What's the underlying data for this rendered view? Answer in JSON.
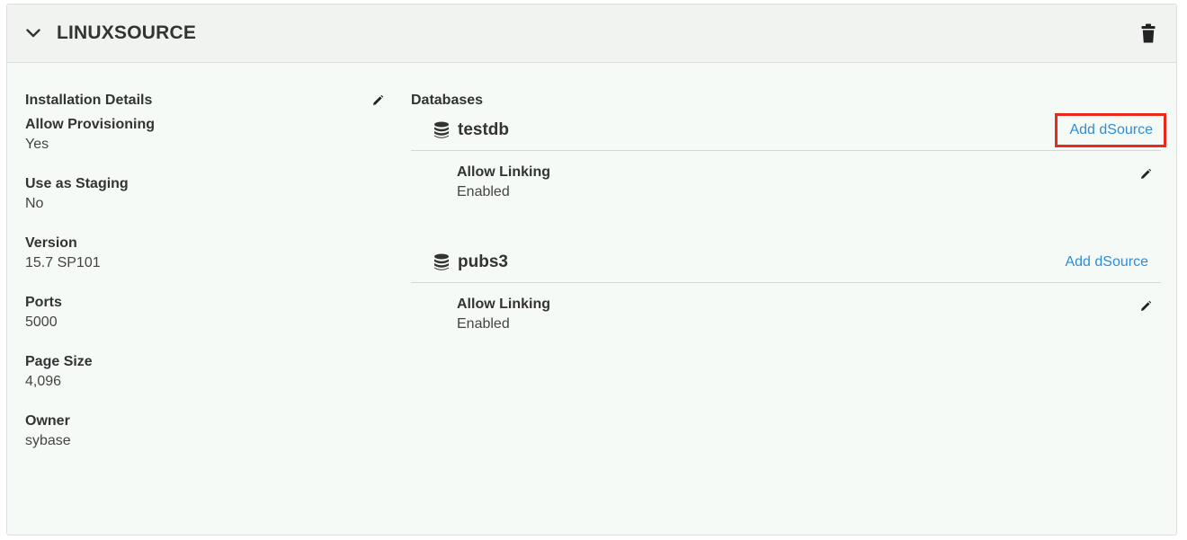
{
  "header": {
    "title": "LINUXSOURCE",
    "chevron_icon": "chevron-down-icon",
    "delete_icon": "trash-icon"
  },
  "installation": {
    "section_title": "Installation Details",
    "edit_icon": "pencil-icon",
    "details": [
      {
        "label": "Allow Provisioning",
        "value": "Yes"
      },
      {
        "label": "Use as Staging",
        "value": "No"
      },
      {
        "label": "Version",
        "value": "15.7 SP101"
      },
      {
        "label": "Ports",
        "value": "5000"
      },
      {
        "label": "Page Size",
        "value": "4,096"
      },
      {
        "label": "Owner",
        "value": "sybase"
      }
    ]
  },
  "databases": {
    "section_title": "Databases",
    "items": [
      {
        "name": "testdb",
        "add_label": "Add dSource",
        "highlighted": true,
        "detail_label": "Allow Linking",
        "detail_value": "Enabled"
      },
      {
        "name": "pubs3",
        "add_label": "Add dSource",
        "highlighted": false,
        "detail_label": "Allow Linking",
        "detail_value": "Enabled"
      }
    ]
  },
  "colors": {
    "link": "#2d8dd6",
    "highlight_border": "#e8291c",
    "panel_bg": "#f6faf7",
    "header_bg": "#f1f3f1"
  }
}
